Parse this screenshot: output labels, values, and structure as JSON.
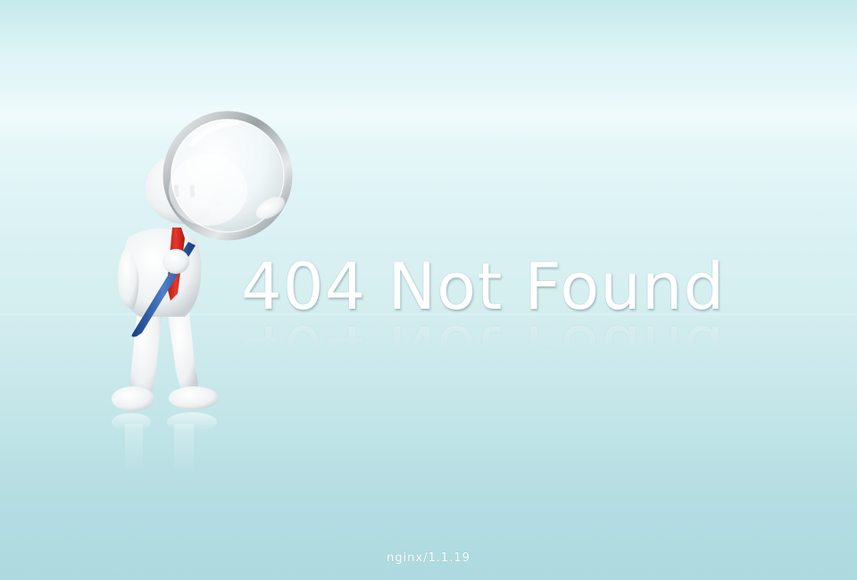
{
  "error": {
    "heading": "404 Not Found"
  },
  "server": {
    "signature": "nginx/1.1.19"
  },
  "colors": {
    "background_top": "#c6e9ec",
    "background_bottom": "#addadf",
    "text": "#ffffff",
    "tie": "#d8271f",
    "handle": "#2a5aa8"
  },
  "icons": {
    "illustration": "magnifier-figure-illustration"
  }
}
